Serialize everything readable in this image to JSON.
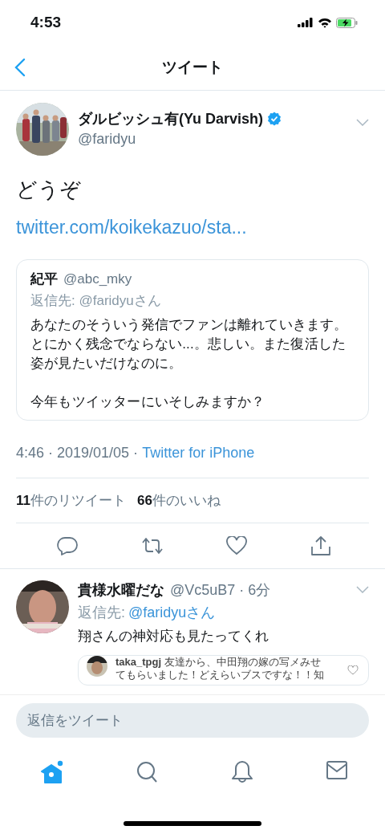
{
  "status_bar": {
    "time": "4:53"
  },
  "nav": {
    "title": "ツイート"
  },
  "tweet": {
    "author": {
      "name": "ダルビッシュ有(Yu Darvish)",
      "handle": "@faridyu",
      "verified": true
    },
    "text": "どうぞ",
    "link": "twitter.com/koikekazuo/sta...",
    "quote": {
      "name": "紀平",
      "handle": "@abc_mky",
      "reply_to": "返信先: @faridyuさん",
      "paragraphs": [
        "あなたのそういう発信でファンは離れていきます。とにかく残念でならない...。悲しい。また復活した姿が見たいだけなのに。",
        "今年もツイッターにいそしみますか？"
      ]
    },
    "timestamp": "4:46 · 2019/01/05 ·",
    "source": "Twitter for iPhone",
    "stats": [
      {
        "count": "11",
        "label": "件のリツイート"
      },
      {
        "count": "66",
        "label": "件のいいね"
      }
    ]
  },
  "reply": {
    "name": "貴様水曜だな",
    "meta": "@Vc5uB7 · 6分",
    "reply_to_label": "返信先:",
    "reply_to_handle": "@faridyuさん",
    "text": "翔さんの神対応も見たってくれ",
    "attachment": {
      "user": "taka_tpgj",
      "lines": [
        "友達から、中田翔の嫁の写メみせ",
        "てもらいました！どえらいブスですな！！知"
      ]
    }
  },
  "compose": {
    "placeholder": "返信をツイート"
  },
  "tab_bar": [
    {
      "kind": "home",
      "selected": true,
      "badge": true
    },
    {
      "kind": "search",
      "selected": false,
      "badge": false
    },
    {
      "kind": "notifications",
      "selected": false,
      "badge": false
    },
    {
      "kind": "messages",
      "selected": false,
      "badge": false
    }
  ]
}
